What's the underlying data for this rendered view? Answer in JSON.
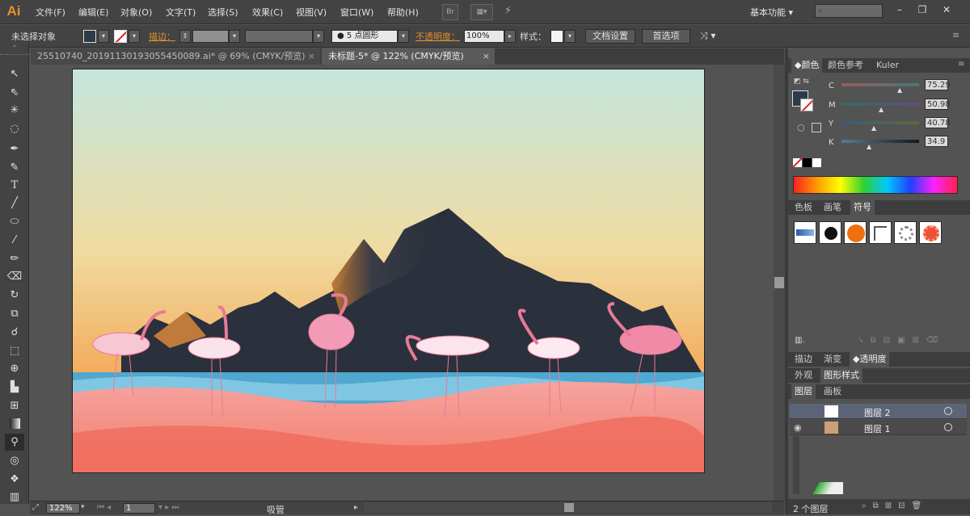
{
  "app": {
    "logo": "Ai"
  },
  "menu": [
    "文件(F)",
    "编辑(E)",
    "对象(O)",
    "文字(T)",
    "选择(S)",
    "效果(C)",
    "视图(V)",
    "窗口(W)",
    "帮助(H)"
  ],
  "menubar": {
    "br_label": "Br",
    "workspace": "基本功能"
  },
  "control": {
    "selection": "未选择对象",
    "stroke_label": "描边：",
    "brush": "5 点圆形",
    "opacity_label": "不透明度：",
    "opacity_value": "100%",
    "style_label": "样式：",
    "doc_setup": "文档设置",
    "prefs": "首选项"
  },
  "tabs": [
    {
      "label": "25510740_20191130193055450089.ai* @ 69% (CMYK/预览)",
      "active": false
    },
    {
      "label": "未标题-5* @ 122% (CMYK/预览)",
      "active": true
    }
  ],
  "tools": [
    "selection-tool",
    "direct-selection-tool",
    "magic-wand-tool",
    "lasso-tool",
    "pen-tool",
    "curvature-tool",
    "type-tool",
    "line-tool",
    "ellipse-tool",
    "paintbrush-tool",
    "pencil-tool",
    "eraser-tool",
    "rotate-tool",
    "scale-tool",
    "warp-tool",
    "free-transform-tool",
    "shape-builder-tool",
    "perspective-tool",
    "mesh-tool",
    "gradient-tool",
    "eyedropper-tool",
    "blend-tool",
    "symbol-sprayer-tool",
    "graph-tool"
  ],
  "status": {
    "zoom": "122%",
    "page": "1",
    "tool": "吸管"
  },
  "color_panel": {
    "tabs": [
      "颜色",
      "颜色参考",
      "Kuler"
    ],
    "channels": [
      {
        "label": "C",
        "value": "75.29",
        "level": 0.75
      },
      {
        "label": "M",
        "value": "50.98",
        "level": 0.51
      },
      {
        "label": "Y",
        "value": "40.78",
        "level": 0.41
      },
      {
        "label": "K",
        "value": "34.9",
        "level": 0.35
      }
    ]
  },
  "symbols_panel": {
    "tabs": [
      "色板",
      "画笔",
      "符号"
    ]
  },
  "mid_tabs": [
    "描边",
    "渐变",
    "透明度"
  ],
  "style_tabs": [
    "外观",
    "图形样式"
  ],
  "layers_panel": {
    "tabs": [
      "图层",
      "画板"
    ],
    "layers": [
      {
        "name": "图层 2"
      },
      {
        "name": "图层 1"
      }
    ],
    "count": "2 个图层"
  },
  "colors": {
    "accent": "#e0902a",
    "flamingo": "#f08aa6",
    "mountain": "#2e3441",
    "water": "#4fa8d0",
    "sand": "#f2877a",
    "sky_top": "#c4e6de",
    "sky_bottom": "#f1a052"
  }
}
